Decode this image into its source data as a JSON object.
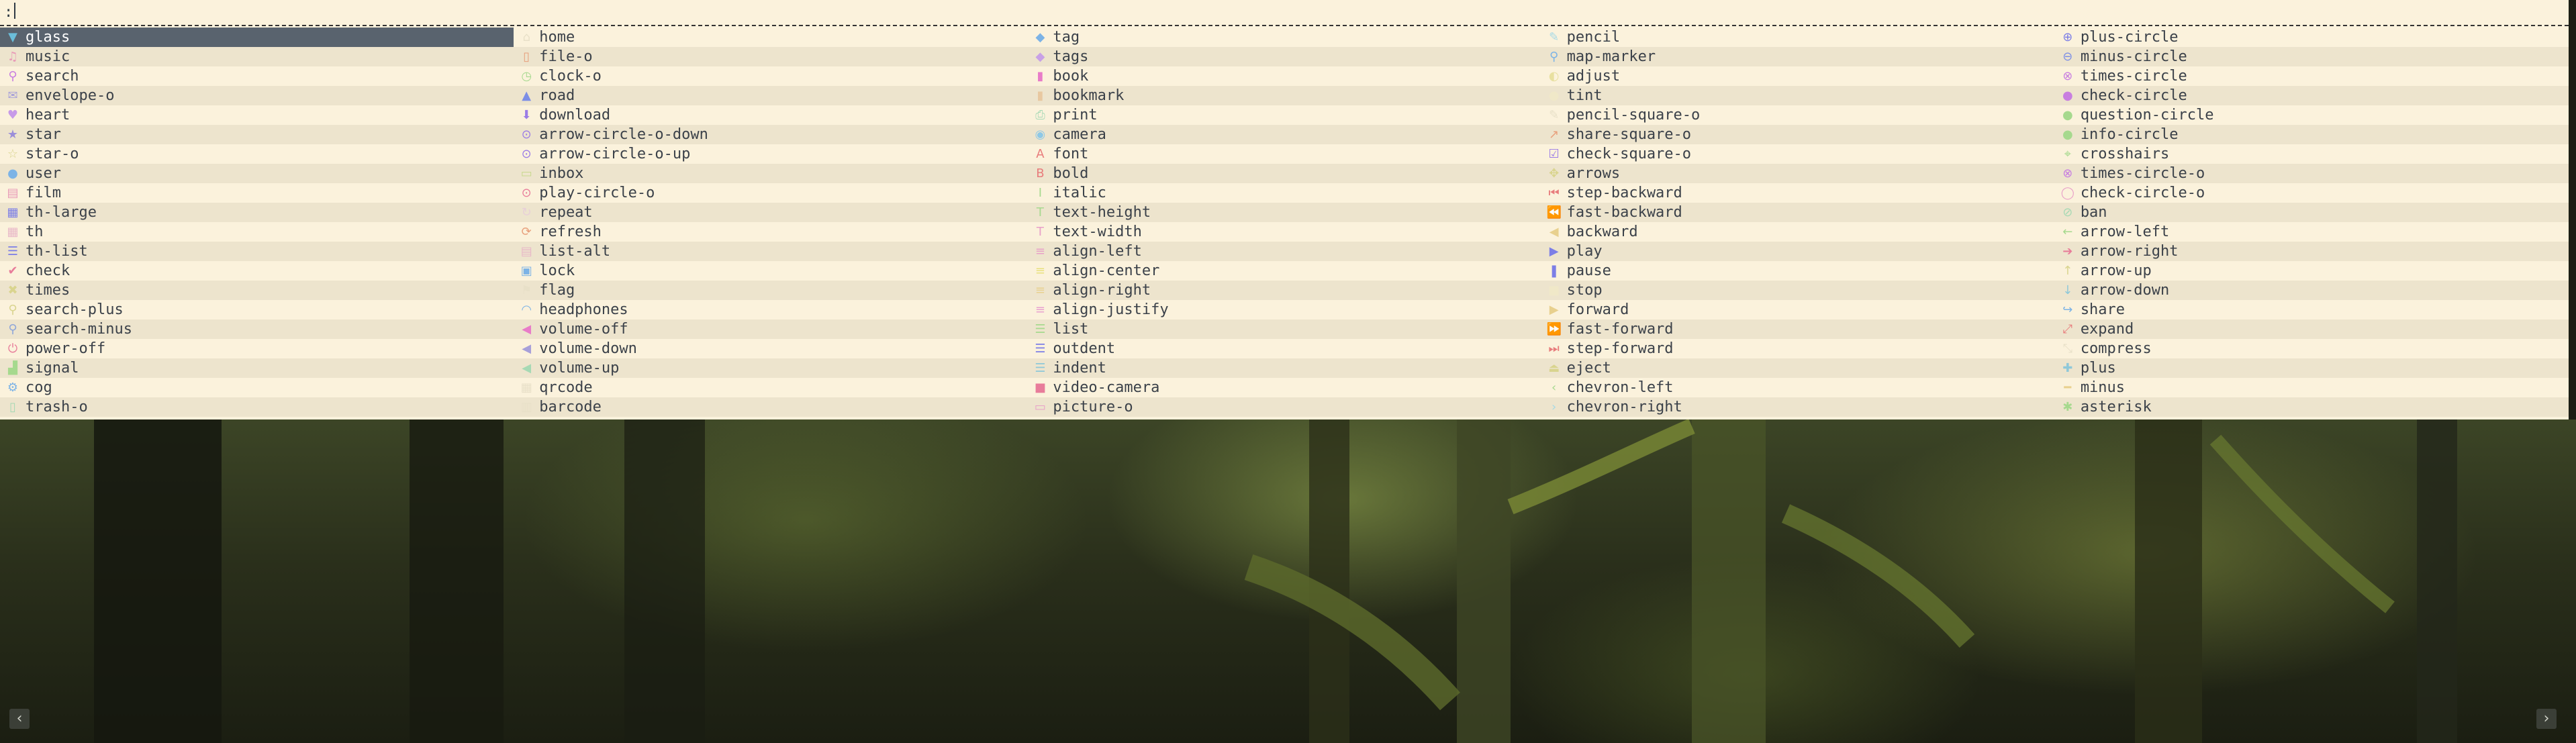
{
  "prompt": {
    "text": ":"
  },
  "selected_index": 0,
  "colors": {
    "menu_bg": "#fbf2dc",
    "alt_row_bg": "#ede4cd",
    "selected_bg": "#59636e",
    "text": "#3b4149"
  },
  "columns": [
    [
      "glass",
      "music",
      "search",
      "envelope-o",
      "heart",
      "star",
      "star-o",
      "user",
      "film",
      "th-large",
      "th",
      "th-list",
      "check",
      "times",
      "search-plus",
      "search-minus",
      "power-off",
      "signal",
      "cog",
      "trash-o"
    ],
    [
      "home",
      "file-o",
      "clock-o",
      "road",
      "download",
      "arrow-circle-o-down",
      "arrow-circle-o-up",
      "inbox",
      "play-circle-o",
      "repeat",
      "refresh",
      "list-alt",
      "lock",
      "flag",
      "headphones",
      "volume-off",
      "volume-down",
      "volume-up",
      "qrcode",
      "barcode"
    ],
    [
      "tag",
      "tags",
      "book",
      "bookmark",
      "print",
      "camera",
      "font",
      "bold",
      "italic",
      "text-height",
      "text-width",
      "align-left",
      "align-center",
      "align-right",
      "align-justify",
      "list",
      "outdent",
      "indent",
      "video-camera",
      "picture-o"
    ],
    [
      "pencil",
      "map-marker",
      "adjust",
      "tint",
      "pencil-square-o",
      "share-square-o",
      "check-square-o",
      "arrows",
      "step-backward",
      "fast-backward",
      "backward",
      "play",
      "pause",
      "stop",
      "forward",
      "fast-forward",
      "step-forward",
      "eject",
      "chevron-left",
      "chevron-right"
    ],
    [
      "plus-circle",
      "minus-circle",
      "times-circle",
      "check-circle",
      "question-circle",
      "info-circle",
      "crosshairs",
      "times-circle-o",
      "check-circle-o",
      "ban",
      "arrow-left",
      "arrow-right",
      "arrow-up",
      "arrow-down",
      "share",
      "expand",
      "compress",
      "plus",
      "minus",
      "asterisk"
    ]
  ],
  "icons": {
    "glass": {
      "glyph": "▼",
      "color": "#6bbdd9"
    },
    "music": {
      "glyph": "♫",
      "color": "#e89ab8"
    },
    "search": {
      "glyph": "⚲",
      "color": "#c87ee0"
    },
    "envelope-o": {
      "glyph": "✉",
      "color": "#a7a0d9"
    },
    "heart": {
      "glyph": "♥",
      "color": "#c79ae8"
    },
    "star": {
      "glyph": "★",
      "color": "#9b8ed9"
    },
    "star-o": {
      "glyph": "☆",
      "color": "#d9d48e"
    },
    "user": {
      "glyph": "●",
      "color": "#7cb3e6"
    },
    "film": {
      "glyph": "▤",
      "color": "#e89ab8"
    },
    "th-large": {
      "glyph": "▦",
      "color": "#7c7ee6"
    },
    "th": {
      "glyph": "▦",
      "color": "#e8b7c8"
    },
    "th-list": {
      "glyph": "☰",
      "color": "#7c7ee6"
    },
    "check": {
      "glyph": "✔",
      "color": "#e87c9a"
    },
    "times": {
      "glyph": "✖",
      "color": "#d9d48e"
    },
    "search-plus": {
      "glyph": "⚲",
      "color": "#d9d48e"
    },
    "search-minus": {
      "glyph": "⚲",
      "color": "#8ea6d9"
    },
    "power-off": {
      "glyph": "⏻",
      "color": "#e87c9a"
    },
    "signal": {
      "glyph": "▟",
      "color": "#a6d98e"
    },
    "cog": {
      "glyph": "⚙",
      "color": "#7cb3e6"
    },
    "trash-o": {
      "glyph": "▯",
      "color": "#a6d9b4"
    },
    "home": {
      "glyph": "⌂",
      "color": "#e8e0c8"
    },
    "file-o": {
      "glyph": "▯",
      "color": "#e8a07c"
    },
    "clock-o": {
      "glyph": "◷",
      "color": "#a6d98e"
    },
    "road": {
      "glyph": "▲",
      "color": "#7c8ee6"
    },
    "download": {
      "glyph": "⬇",
      "color": "#9b7ce6"
    },
    "arrow-circle-o-down": {
      "glyph": "⊙",
      "color": "#9b7ce6"
    },
    "arrow-circle-o-up": {
      "glyph": "⊙",
      "color": "#9b7ce6"
    },
    "inbox": {
      "glyph": "▭",
      "color": "#c8d98e"
    },
    "play-circle-o": {
      "glyph": "⊙",
      "color": "#e87c9a"
    },
    "repeat": {
      "glyph": "↻",
      "color": "#e8d0d8"
    },
    "refresh": {
      "glyph": "⟳",
      "color": "#e8a07c"
    },
    "list-alt": {
      "glyph": "▤",
      "color": "#e8b7c8"
    },
    "lock": {
      "glyph": "▣",
      "color": "#7cb3e6"
    },
    "flag": {
      "glyph": "⚑",
      "color": "#e8e0c8"
    },
    "headphones": {
      "glyph": "◠",
      "color": "#7cb3e6"
    },
    "volume-off": {
      "glyph": "◀",
      "color": "#e87cc8"
    },
    "volume-down": {
      "glyph": "◀",
      "color": "#a7a0d9"
    },
    "volume-up": {
      "glyph": "◀",
      "color": "#a6d9b4"
    },
    "qrcode": {
      "glyph": "▦",
      "color": "#e8e0c8"
    },
    "barcode": {
      "glyph": "▥",
      "color": "#e8e0c8"
    },
    "tag": {
      "glyph": "◆",
      "color": "#7cb3e6"
    },
    "tags": {
      "glyph": "◆",
      "color": "#c8a0e6"
    },
    "book": {
      "glyph": "▮",
      "color": "#e87cc8"
    },
    "bookmark": {
      "glyph": "▮",
      "color": "#e8c8a0"
    },
    "print": {
      "glyph": "⎙",
      "color": "#a6d9b4"
    },
    "camera": {
      "glyph": "◉",
      "color": "#8ec8e6"
    },
    "font": {
      "glyph": "A",
      "color": "#e87c7c"
    },
    "bold": {
      "glyph": "B",
      "color": "#e87c7c"
    },
    "italic": {
      "glyph": "I",
      "color": "#a6d98e"
    },
    "text-height": {
      "glyph": "T",
      "color": "#a6d98e"
    },
    "text-width": {
      "glyph": "T",
      "color": "#e8a0c8"
    },
    "align-left": {
      "glyph": "≡",
      "color": "#e8a0c8"
    },
    "align-center": {
      "glyph": "≡",
      "color": "#e8e07c"
    },
    "align-right": {
      "glyph": "≡",
      "color": "#e8d08e"
    },
    "align-justify": {
      "glyph": "≡",
      "color": "#e8a0d0"
    },
    "list": {
      "glyph": "☰",
      "color": "#a6d98e"
    },
    "outdent": {
      "glyph": "☰",
      "color": "#7c7ee6"
    },
    "indent": {
      "glyph": "☰",
      "color": "#8ec8d9"
    },
    "video-camera": {
      "glyph": "■",
      "color": "#e87c9a"
    },
    "picture-o": {
      "glyph": "▭",
      "color": "#e8a0c8"
    },
    "pencil": {
      "glyph": "✎",
      "color": "#a6d9e6"
    },
    "map-marker": {
      "glyph": "⚲",
      "color": "#7cb3e6"
    },
    "adjust": {
      "glyph": "◐",
      "color": "#e8e0a0"
    },
    "tint": {
      "glyph": "●",
      "color": "#f0e8c8"
    },
    "pencil-square-o": {
      "glyph": "✎",
      "color": "#e8e0c8"
    },
    "share-square-o": {
      "glyph": "↗",
      "color": "#e8a07c"
    },
    "check-square-o": {
      "glyph": "☑",
      "color": "#9b7ce6"
    },
    "arrows": {
      "glyph": "✥",
      "color": "#d9d48e"
    },
    "step-backward": {
      "glyph": "⏮",
      "color": "#e87c7c"
    },
    "fast-backward": {
      "glyph": "⏪",
      "color": "#a6d98e"
    },
    "backward": {
      "glyph": "◀",
      "color": "#e8d08e"
    },
    "play": {
      "glyph": "▶",
      "color": "#7c7ee6"
    },
    "pause": {
      "glyph": "❚",
      "color": "#7c7ee6"
    },
    "stop": {
      "glyph": "■",
      "color": "#f0e8c8"
    },
    "forward": {
      "glyph": "▶",
      "color": "#e8d08e"
    },
    "fast-forward": {
      "glyph": "⏩",
      "color": "#e8a07c"
    },
    "step-forward": {
      "glyph": "⏭",
      "color": "#e87c7c"
    },
    "eject": {
      "glyph": "⏏",
      "color": "#d9d48e"
    },
    "chevron-left": {
      "glyph": "‹",
      "color": "#a6d98e"
    },
    "chevron-right": {
      "glyph": "›",
      "color": "#a6d9e6"
    },
    "plus-circle": {
      "glyph": "⊕",
      "color": "#7c7ee6"
    },
    "minus-circle": {
      "glyph": "⊖",
      "color": "#7c8ee6"
    },
    "times-circle": {
      "glyph": "⊗",
      "color": "#c87ee0"
    },
    "check-circle": {
      "glyph": "●",
      "color": "#c87ee0"
    },
    "question-circle": {
      "glyph": "●",
      "color": "#a6d98e"
    },
    "info-circle": {
      "glyph": "●",
      "color": "#a6d98e"
    },
    "crosshairs": {
      "glyph": "⌖",
      "color": "#a6d98e"
    },
    "times-circle-o": {
      "glyph": "⊗",
      "color": "#c87ee0"
    },
    "check-circle-o": {
      "glyph": "◯",
      "color": "#e8a0c8"
    },
    "ban": {
      "glyph": "⊘",
      "color": "#a6d9b4"
    },
    "arrow-left": {
      "glyph": "←",
      "color": "#a6d98e"
    },
    "arrow-right": {
      "glyph": "➔",
      "color": "#e87c9a"
    },
    "arrow-up": {
      "glyph": "↑",
      "color": "#d9d48e"
    },
    "arrow-down": {
      "glyph": "↓",
      "color": "#8ec8d9"
    },
    "share": {
      "glyph": "↪",
      "color": "#7cb3e6"
    },
    "expand": {
      "glyph": "⤢",
      "color": "#e87c7c"
    },
    "compress": {
      "glyph": "⤡",
      "color": "#e8e0c8"
    },
    "plus": {
      "glyph": "✚",
      "color": "#8ec8d9"
    },
    "minus": {
      "glyph": "━",
      "color": "#e8d08e"
    },
    "asterisk": {
      "glyph": "✱",
      "color": "#a6d98e"
    }
  },
  "background": {
    "nav_prev_glyph": "‹",
    "nav_next_glyph": "›"
  }
}
